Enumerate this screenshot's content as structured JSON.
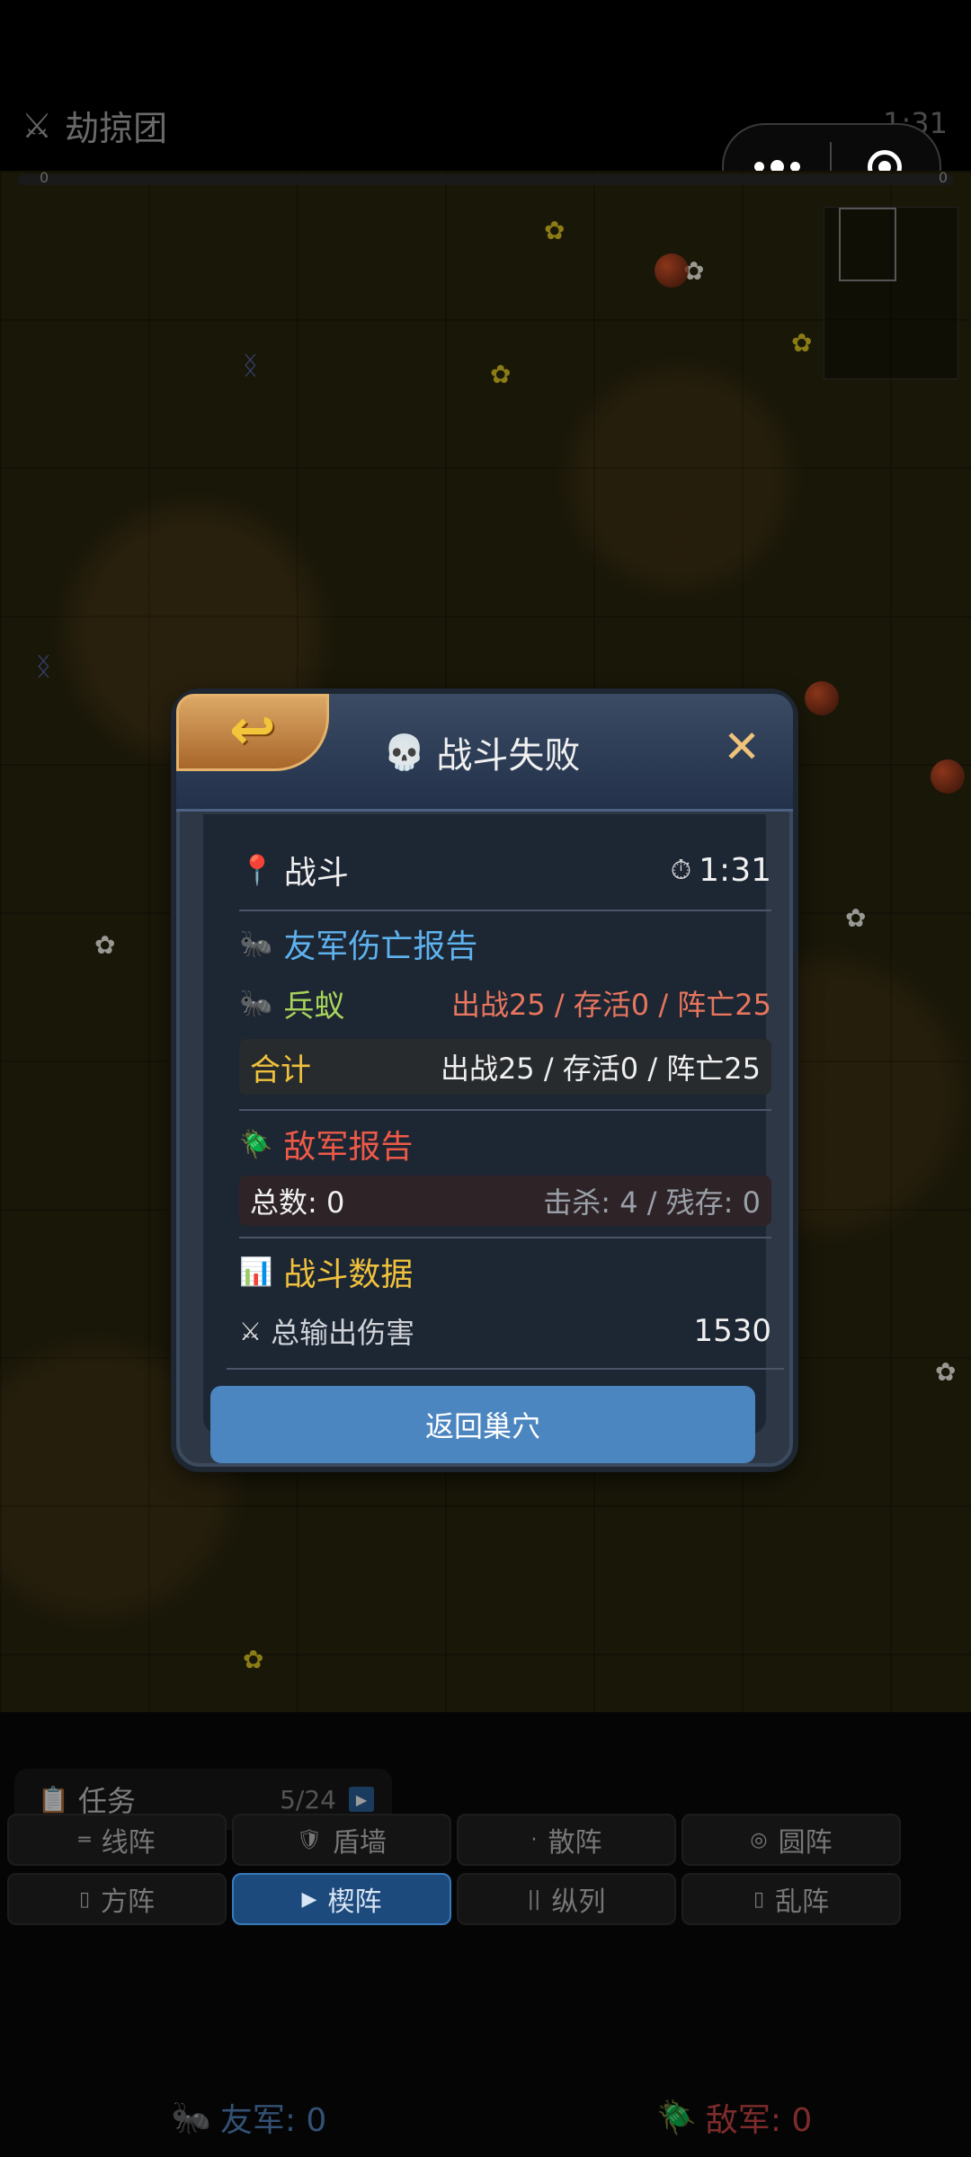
{
  "topbar": {
    "title": "劫掠团",
    "timer": "1:31",
    "progress_left": "0",
    "progress_right": "0"
  },
  "task": {
    "label": "任务",
    "count": "5/24"
  },
  "formations": [
    {
      "label": "线阵",
      "icon": "═",
      "active": false
    },
    {
      "label": "盾墙",
      "icon": "🛡",
      "active": false
    },
    {
      "label": "散阵",
      "icon": "·",
      "active": false
    },
    {
      "label": "圆阵",
      "icon": "◎",
      "active": false
    },
    {
      "label": "方阵",
      "icon": "▯",
      "active": false
    },
    {
      "label": "楔阵",
      "icon": "▶",
      "active": true
    },
    {
      "label": "纵列",
      "icon": "||",
      "active": false
    },
    {
      "label": "乱阵",
      "icon": "▯",
      "active": false
    }
  ],
  "armies": {
    "friend": "友军: 0",
    "enemy": "敌军: 0"
  },
  "dialog": {
    "title": "战斗失败",
    "battle_label": "战斗",
    "battle_time": "1:31",
    "friendly_section": "友军伤亡报告",
    "unit_name": "兵蚁",
    "unit_stats": "出战25 / 存活0 / 阵亡25",
    "total_label": "合计",
    "total_stats": "出战25 / 存活0 / 阵亡25",
    "enemy_section": "敌军报告",
    "enemy_total": "总数: 0",
    "enemy_stats": "击杀: 4 / 残存: 0",
    "data_section": "战斗数据",
    "damage_label": "总输出伤害",
    "damage_value": "1530",
    "return_button": "返回巢穴"
  },
  "colors": {
    "accent_blue": "#4c86c0",
    "friendly_header": "#5eb2ee",
    "enemy_header": "#ef5a48",
    "data_header": "#f0c23c",
    "unit_green": "#a8d45a"
  }
}
